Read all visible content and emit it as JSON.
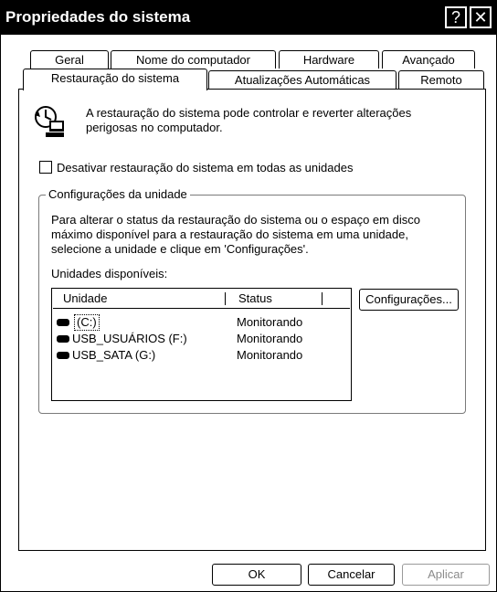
{
  "window": {
    "title": "Propriedades do sistema",
    "help_button": "?",
    "close_button": "✕"
  },
  "tabs": {
    "row1": [
      "Geral",
      "Nome do computador",
      "Hardware",
      "Avançado"
    ],
    "row2": [
      "Restauração do sistema",
      "Atualizações Automáticas",
      "Remoto"
    ],
    "active": "Restauração do sistema"
  },
  "intro": {
    "icon": "system-restore-icon",
    "line1": "A restauração do sistema pode controlar e reverter alterações",
    "line2": "perigosas no computador."
  },
  "disable_checkbox": {
    "label": "Desativar restauração do sistema em todas as unidades",
    "checked": false
  },
  "drive_settings": {
    "group_label": "Configurações da unidade",
    "desc_line1": "Para alterar o status da restauração do sistema ou o espaço em disco",
    "desc_line2": "máximo disponível para a restauração do sistema em uma unidade,",
    "desc_line3": "selecione a unidade e clique em 'Configurações'.",
    "available_label": "Unidades disponíveis:",
    "columns": [
      "Unidade",
      "Status"
    ],
    "drives": [
      {
        "name": "(C:)",
        "status": "Monitorando",
        "icon": "drive-icon"
      },
      {
        "name": "USB_USUÁRIOS (F:)",
        "status": "Monitorando",
        "icon": "drive-icon"
      },
      {
        "name": "USB_SATA (G:)",
        "status": "Monitorando",
        "icon": "drive-icon"
      }
    ],
    "settings_button": "Configurações..."
  },
  "footer": {
    "ok": "OK",
    "cancel": "Cancelar",
    "apply": "Aplicar"
  }
}
